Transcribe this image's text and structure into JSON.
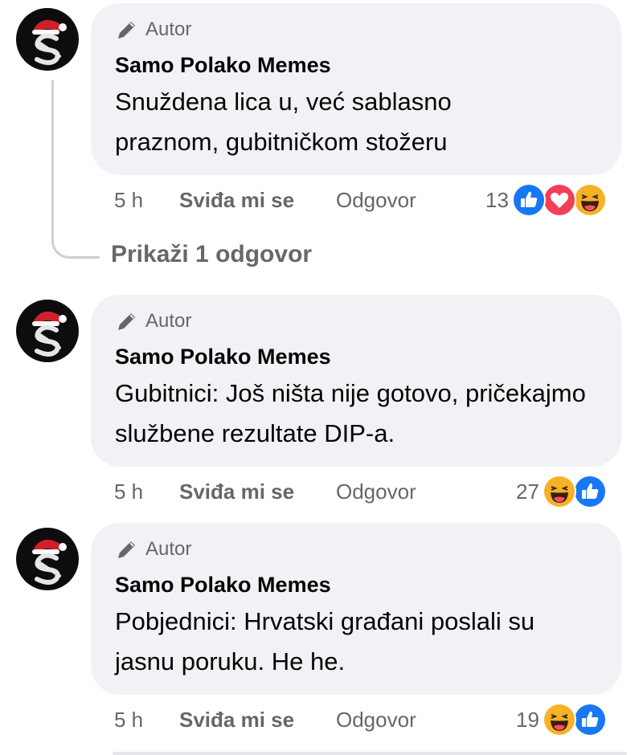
{
  "comments": [
    {
      "badge": "Autor",
      "author": "Samo Polako Memes",
      "text": "Snuždena lica u, već sablasno praznom, gubitničkom stožeru",
      "time": "5 h",
      "like_label": "Sviđa mi se",
      "reply_label": "Odgovor",
      "reaction_count": "13",
      "reactions": [
        "like-icon",
        "love-icon",
        "haha-icon"
      ]
    },
    {
      "badge": "Autor",
      "author": "Samo Polako Memes",
      "text": "Gubitnici: Još ništa nije gotovo, pričekajmo službene rezultate DIP-a.",
      "time": "5 h",
      "like_label": "Sviđa mi se",
      "reply_label": "Odgovor",
      "reaction_count": "27",
      "reactions": [
        "haha-icon",
        "like-icon"
      ]
    },
    {
      "badge": "Autor",
      "author": "Samo Polako Memes",
      "text": "Pobjednici: Hrvatski građani poslali su jasnu poruku. He he.",
      "time": "5 h",
      "like_label": "Sviđa mi se",
      "reply_label": "Odgovor",
      "reaction_count": "19",
      "reactions": [
        "haha-icon",
        "like-icon"
      ]
    }
  ],
  "thread": {
    "show_replies_label": "Prikaži 1 odgovor"
  },
  "colors": {
    "like": "#1877f2",
    "love": "#f33e58",
    "haha": "#f7b125",
    "bubble": "#f0f2f5",
    "meta": "#65676b"
  }
}
